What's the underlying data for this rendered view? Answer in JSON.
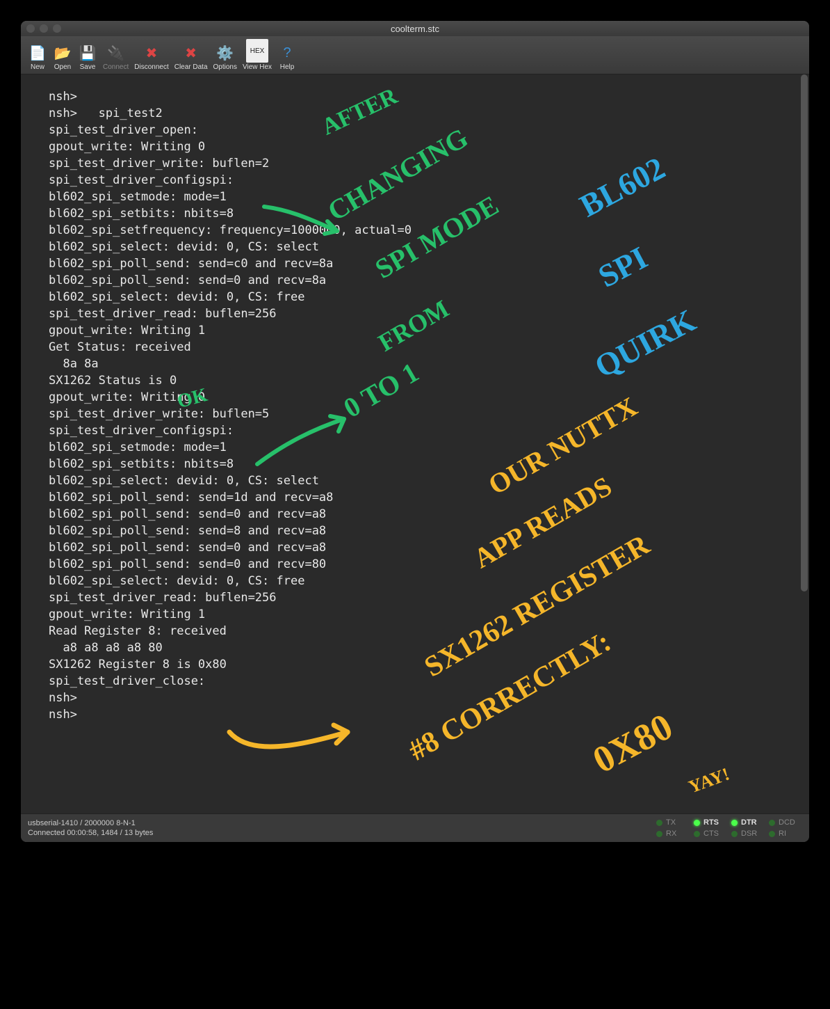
{
  "window": {
    "title": "coolterm.stc"
  },
  "toolbar": {
    "new_label": "New",
    "open_label": "Open",
    "save_label": "Save",
    "connect_label": "Connect",
    "disconnect_label": "Disconnect",
    "clear_label": "Clear Data",
    "options_label": "Options",
    "viewhex_label": "View Hex",
    "help_label": "Help"
  },
  "terminal_lines": [
    "nsh>",
    "nsh>   spi_test2",
    "spi_test_driver_open:",
    "gpout_write: Writing 0",
    "spi_test_driver_write: buflen=2",
    "spi_test_driver_configspi:",
    "bl602_spi_setmode: mode=1",
    "bl602_spi_setbits: nbits=8",
    "bl602_spi_setfrequency: frequency=1000000, actual=0",
    "bl602_spi_select: devid: 0, CS: select",
    "bl602_spi_poll_send: send=c0 and recv=8a",
    "bl602_spi_poll_send: send=0 and recv=8a",
    "bl602_spi_select: devid: 0, CS: free",
    "spi_test_driver_read: buflen=256",
    "gpout_write: Writing 1",
    "Get Status: received",
    "  8a 8a",
    "SX1262 Status is 0",
    "gpout_write: Writing 0",
    "spi_test_driver_write: buflen=5",
    "spi_test_driver_configspi:",
    "bl602_spi_setmode: mode=1",
    "bl602_spi_setbits: nbits=8",
    "bl602_spi_select: devid: 0, CS: select",
    "bl602_spi_poll_send: send=1d and recv=a8",
    "bl602_spi_poll_send: send=0 and recv=a8",
    "bl602_spi_poll_send: send=8 and recv=a8",
    "bl602_spi_poll_send: send=0 and recv=a8",
    "bl602_spi_poll_send: send=0 and recv=80",
    "bl602_spi_select: devid: 0, CS: free",
    "spi_test_driver_read: buflen=256",
    "gpout_write: Writing 1",
    "Read Register 8: received",
    "  a8 a8 a8 a8 80",
    "SX1262 Register 8 is 0x80",
    "spi_test_driver_close:",
    "nsh>",
    "nsh>"
  ],
  "status": {
    "port_line": "usbserial-1410 / 2000000 8-N-1",
    "conn_line": "Connected 00:00:58, 1484 / 13 bytes",
    "tx": "TX",
    "rx": "RX",
    "rts": "RTS",
    "cts": "CTS",
    "dtr": "DTR",
    "dsr": "DSR",
    "dcd": "DCD",
    "ri": "RI"
  },
  "annotations": {
    "after": "AFTER",
    "changing": "CHANGING",
    "spi_mode": "SPI MODE",
    "from": "FROM",
    "zero_to_one": "0 TO 1",
    "ok": "OK",
    "bl602": "BL602",
    "spi": "SPI",
    "quirk": "QUIRK",
    "our_nuttx": "OUR NUTTX",
    "app_reads": "APP READS",
    "sx1262_register": "SX1262 REGISTER",
    "num8_correctly": "#8 CORRECTLY:",
    "value": "0X80",
    "yay": "YAY!"
  }
}
